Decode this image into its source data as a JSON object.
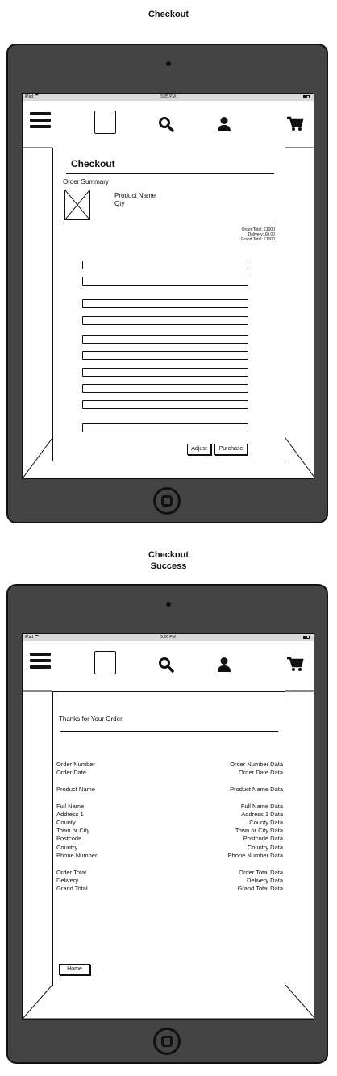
{
  "screens": [
    {
      "caption": "Checkout",
      "status_bar": {
        "device": "iPad",
        "time": "5:25 PM"
      },
      "title": "Checkout",
      "order_summary_label": "Order Summary",
      "product": {
        "name": "Product Name",
        "qty": "Qty"
      },
      "totals": {
        "order_total": "Order Total: £1000",
        "delivery": "Delivery: £0.00",
        "grand_total": "Grand Total: £1000"
      },
      "buttons": {
        "adjust": "Adjust",
        "purchase": "Purchase"
      }
    },
    {
      "caption_line1": "Checkout",
      "caption_line2": "Success",
      "status_bar": {
        "device": "iPad",
        "time": "5:26 PM"
      },
      "heading": "Thanks for Your Order",
      "groups": [
        [
          [
            "Order Number",
            "Order Number Data"
          ],
          [
            "Order Date",
            "Order Date Data"
          ]
        ],
        [
          [
            "Product Name",
            "Product Name Data"
          ]
        ],
        [
          [
            "Full Name",
            "Full Name Data"
          ],
          [
            "Address 1",
            "Address 1 Data"
          ],
          [
            "County",
            "County Data"
          ],
          [
            "Town or City",
            "Town or City Data"
          ],
          [
            "Postcode",
            "Postcode Data"
          ],
          [
            "Country",
            "Country Data"
          ],
          [
            "Phone Number",
            "Phone Number Data"
          ]
        ],
        [
          [
            "Order Total",
            "Order Total Data"
          ],
          [
            "Delivery",
            "Delivery Data"
          ],
          [
            "Grand Total",
            "Grand Total Data"
          ]
        ]
      ],
      "home_button": "Home"
    }
  ],
  "icons": [
    "hamburger-menu-icon",
    "logo-placeholder",
    "search-icon",
    "user-icon",
    "cart-icon"
  ]
}
